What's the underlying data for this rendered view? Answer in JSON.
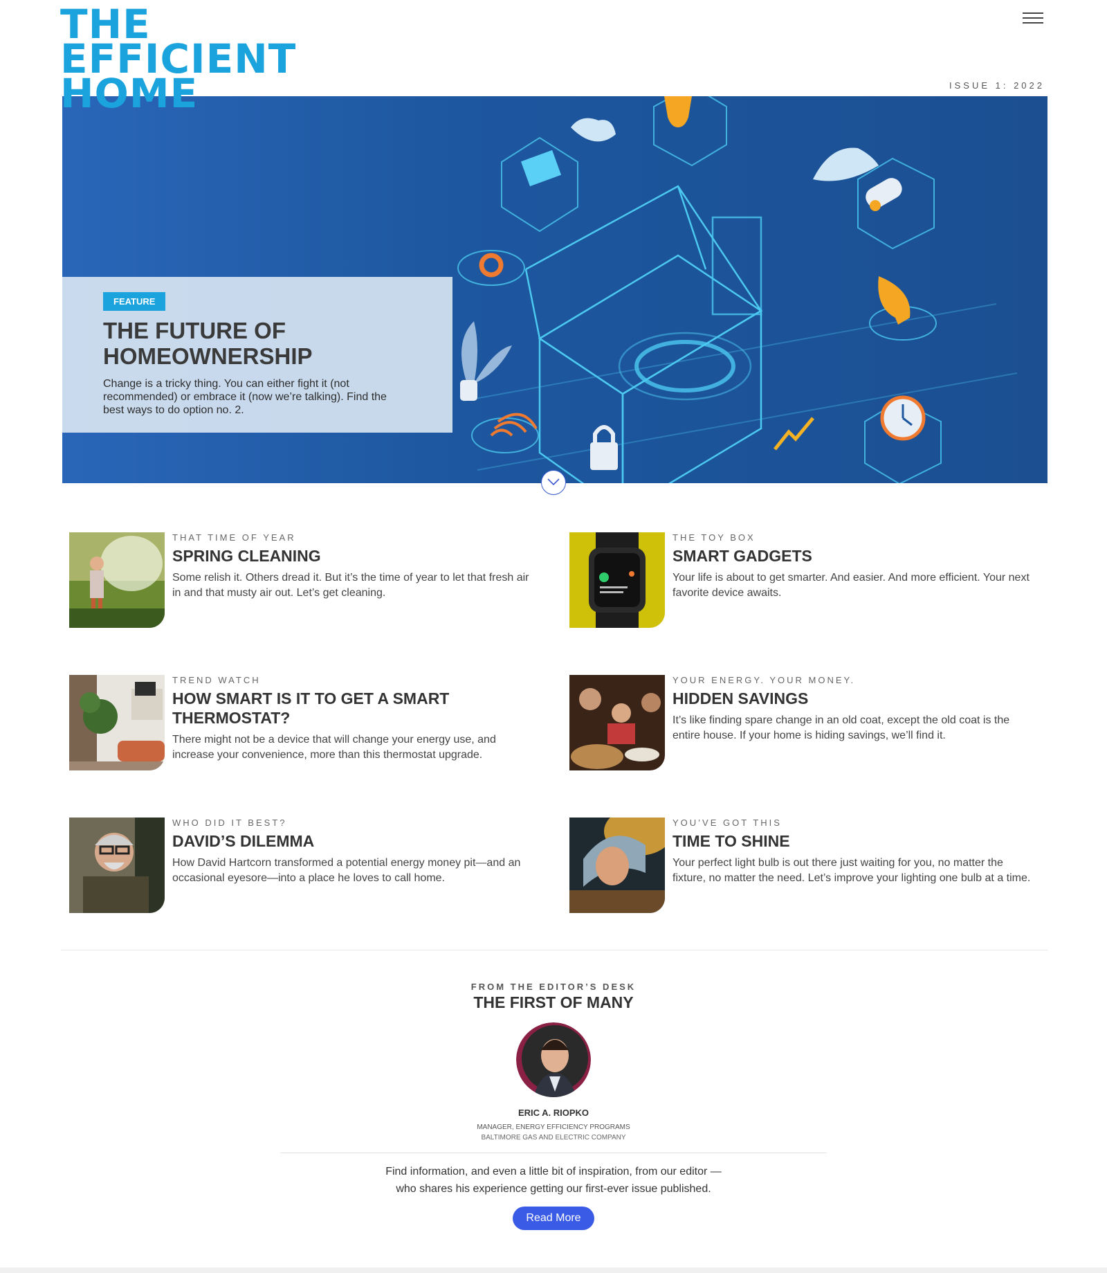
{
  "header": {
    "logo_lines": [
      "THE",
      "EFFICIENT",
      "HOME"
    ],
    "menu_icon": "hamburger-icon",
    "issue": "ISSUE 1: 2022"
  },
  "hero": {
    "tag": "FEATURE",
    "title": "THE FUTURE OF HOMEOWNERSHIP",
    "description": "Change is a tricky thing. You can either fight it (not recommended) or embrace it (now we’re talking). Find the best ways to do option no. 2.",
    "scroll_icon": "chevron-down-icon"
  },
  "articles": [
    {
      "kicker": "THAT TIME OF YEAR",
      "title": "SPRING CLEANING",
      "description": "Some relish it. Others dread it. But it’s the time of year to let that fresh air in and that musty air out. Let’s get cleaning."
    },
    {
      "kicker": "THE TOY BOX",
      "title": "SMART GADGETS",
      "description": "Your life is about to get smarter. And easier. And more efficient. Your next favorite device awaits."
    },
    {
      "kicker": "TREND WATCH",
      "title": "HOW SMART IS IT TO GET A SMART THERMOSTAT?",
      "description": "There might not be a device that will change your energy use, and increase your convenience, more than this thermostat upgrade."
    },
    {
      "kicker": "YOUR ENERGY. YOUR MONEY.",
      "title": "HIDDEN SAVINGS",
      "description": "It’s like finding spare change in an old coat, except the old coat is the entire house. If your home is hiding savings, we’ll find it."
    },
    {
      "kicker": "WHO DID IT BEST?",
      "title": "DAVID’S DILEMMA",
      "description": "How David Hartcorn transformed a potential energy money pit—and an occasional eyesore—into a place he loves to call home."
    },
    {
      "kicker": "YOU’VE GOT THIS",
      "title": "TIME TO SHINE",
      "description": "Your perfect light bulb is out there just waiting for you, no matter the fixture, no matter the need. Let’s improve your lighting one bulb at a time."
    }
  ],
  "editor": {
    "kicker": "FROM THE EDITOR’S DESK",
    "title": "THE FIRST OF MANY",
    "name": "ERIC A. RIOPKO",
    "role": "MANAGER, ENERGY EFFICIENCY PROGRAMS",
    "company": "BALTIMORE GAS AND ELECTRIC COMPANY",
    "text": "Find information, and even a little bit of inspiration, from our editor —who shares his experience getting our first-ever issue published.",
    "button": "Read More"
  },
  "colors": {
    "brand_blue": "#1aa3dc",
    "hero_blue": "#1d579f",
    "button_blue": "#3a5be6"
  }
}
